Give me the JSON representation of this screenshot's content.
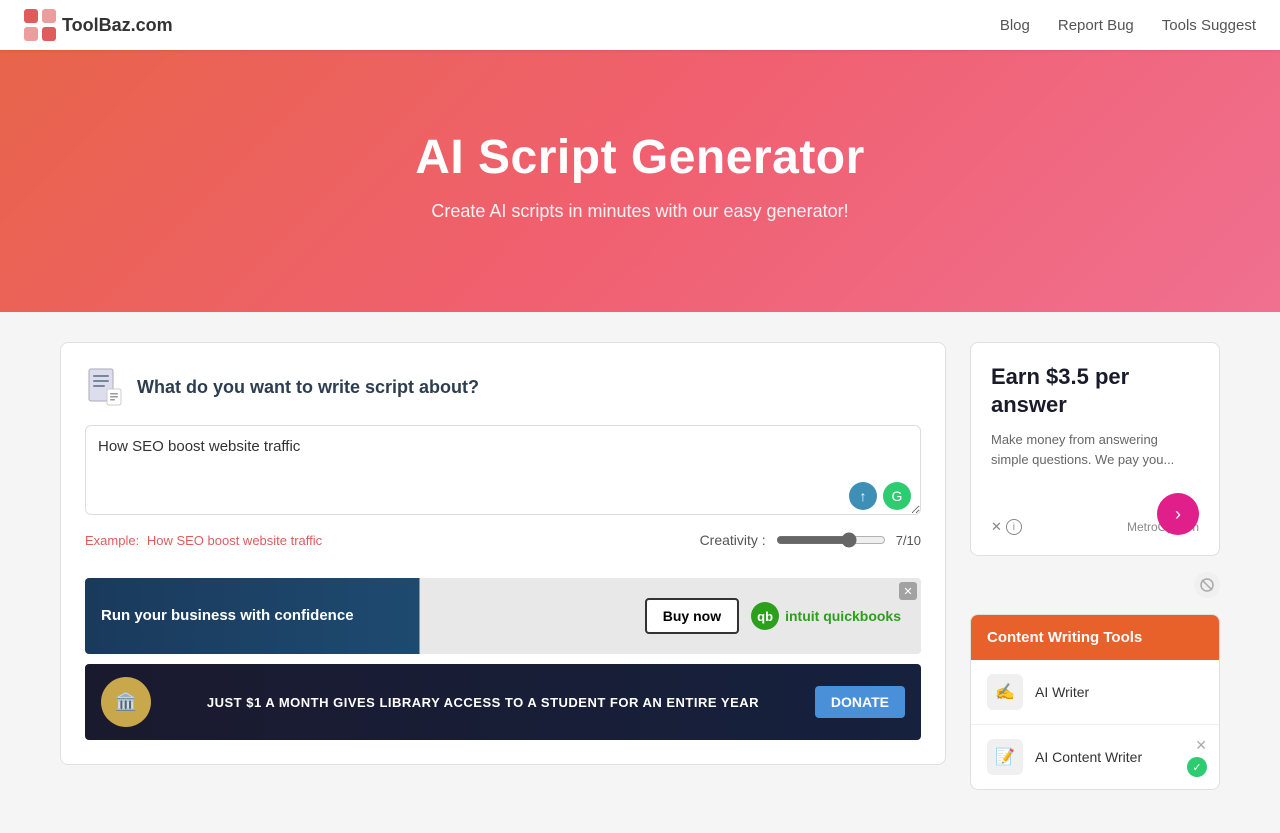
{
  "navbar": {
    "logo_text": "ToolBaz.com",
    "links": [
      {
        "label": "Blog",
        "href": "#"
      },
      {
        "label": "Report Bug",
        "href": "#"
      },
      {
        "label": "Tools Suggest",
        "href": "#"
      }
    ]
  },
  "hero": {
    "title": "AI Script Generator",
    "subtitle": "Create AI scripts in minutes with our easy generator!"
  },
  "panel": {
    "title": "What do you want to write script about?",
    "textarea_value": "How SEO boost website traffic",
    "example_label": "Example:",
    "example_value": "How SEO boost website traffic",
    "creativity_label": "Creativity :",
    "creativity_value": "7/10",
    "creativity_min": "0",
    "creativity_max": "10",
    "creativity_current": "7"
  },
  "ad_banner_1": {
    "text": "Run your business with confidence",
    "buy_label": "Buy now",
    "brand": "intuit quickbooks",
    "close_label": "✕"
  },
  "ad_banner_2": {
    "text": "JUST $1 A MONTH GIVES LIBRARY ACCESS TO A STUDENT FOR AN ENTIRE YEAR",
    "donate_label": "DONATE"
  },
  "ad_card": {
    "title": "Earn $3.5 per answer",
    "subtitle": "Make money from answering simple questions. We pay you...",
    "arrow": "›",
    "brand": "MetroOpinion",
    "x_label": "✕",
    "info_label": "i"
  },
  "content_tools": {
    "header": "Content Writing Tools",
    "items": [
      {
        "name": "AI Writer",
        "icon": "✍"
      },
      {
        "name": "AI Content Writer",
        "icon": "📝"
      }
    ]
  }
}
